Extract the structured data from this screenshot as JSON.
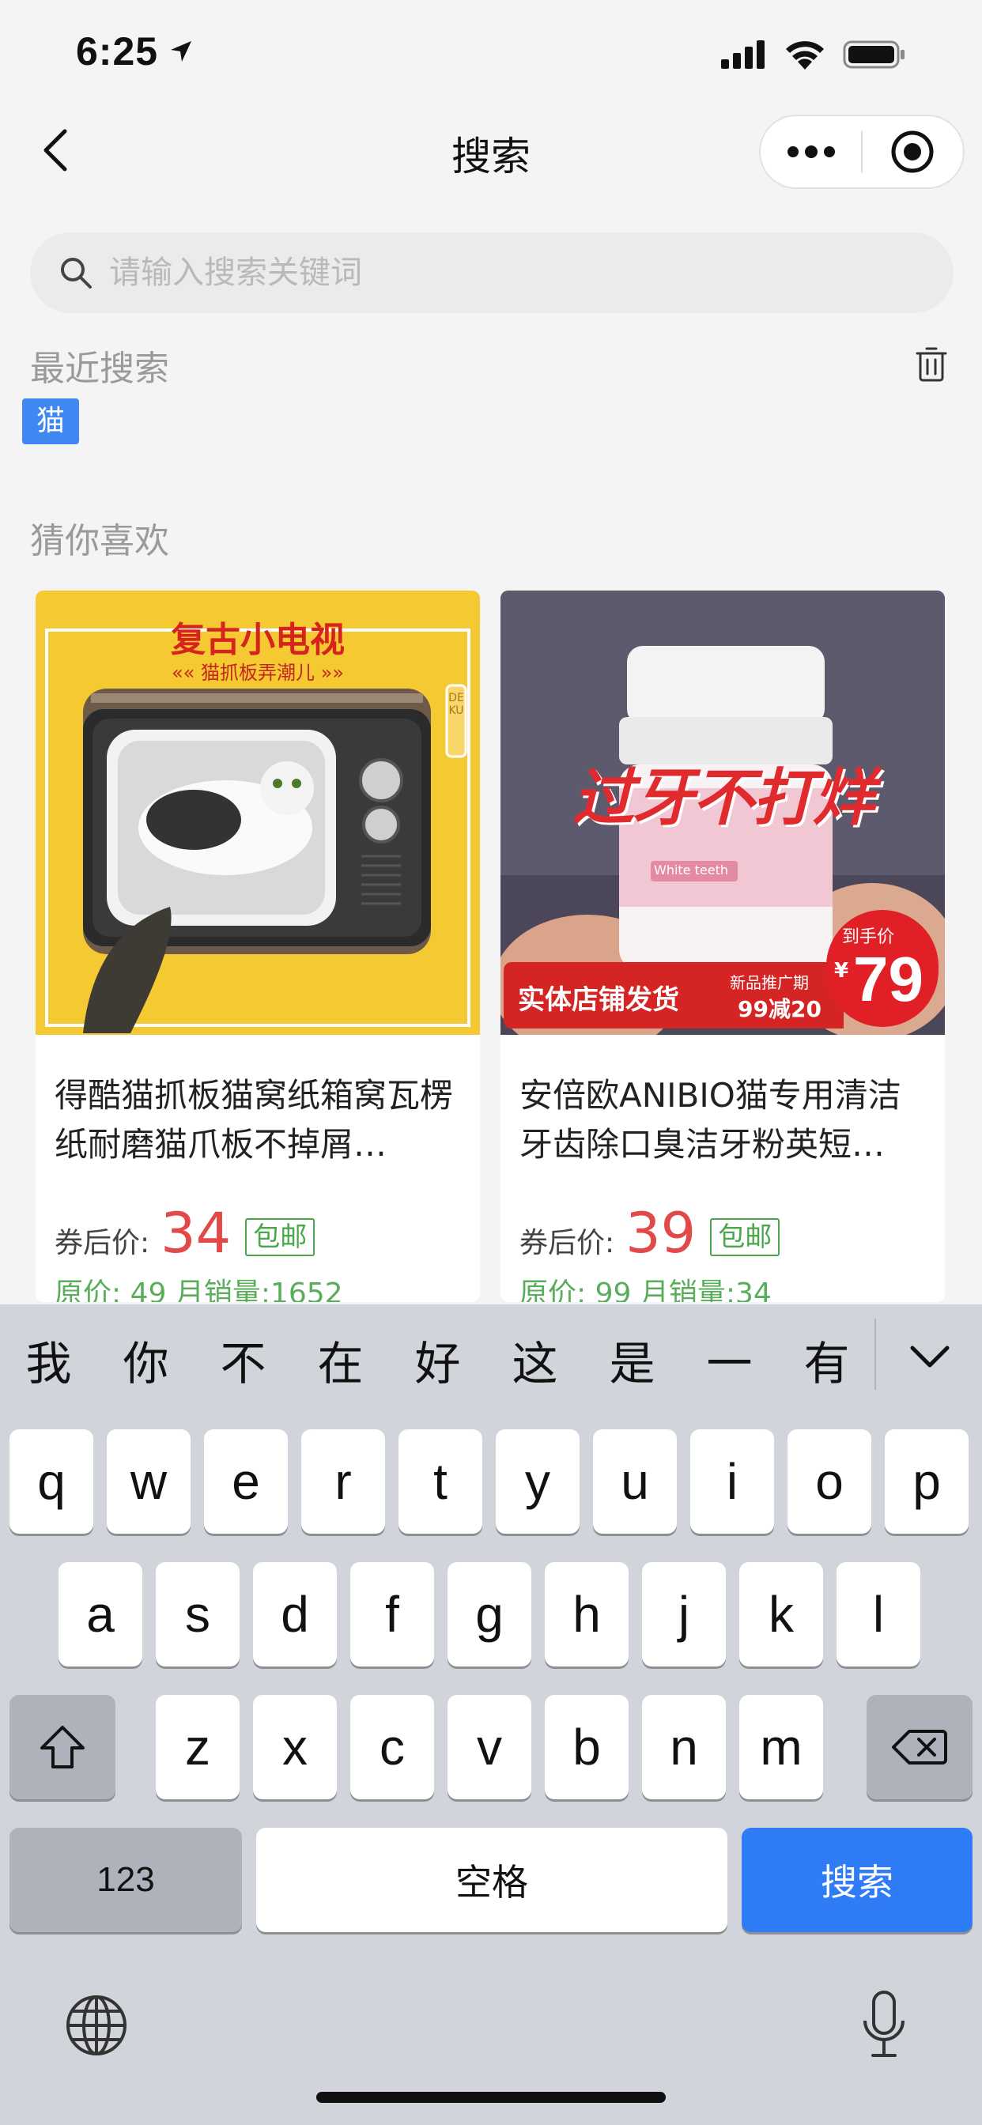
{
  "status_bar": {
    "time": "6:25"
  },
  "nav": {
    "title": "搜索"
  },
  "search": {
    "placeholder": "请输入搜索关键词"
  },
  "recent": {
    "title": "最近搜索",
    "tags": [
      "猫"
    ]
  },
  "recommend": {
    "title": "猜你喜欢",
    "products": [
      {
        "title": "得酷猫抓板猫窝纸箱窝瓦楞纸耐磨猫爪板不掉屑…",
        "price_label": "券后价:",
        "price": "34",
        "badge": "包邮",
        "meta": "原价: 49   月销量:1652",
        "image": {
          "banner": "复古小电视",
          "subtitle": "猫抓板弄潮儿",
          "brand": "DEKU"
        }
      },
      {
        "title": "安倍欧ANIBIO猫专用清洁牙齿除口臭洁牙粉英短…",
        "price_label": "券后价:",
        "price": "39",
        "badge": "包邮",
        "meta": "原价: 99   月销量:34",
        "image": {
          "headline": "过牙不打烊",
          "jar_label": "White teeth",
          "store": "实体店铺发货",
          "promo_top": "新品推广期",
          "promo_bottom": "99减20",
          "final_label": "到手价",
          "final_currency": "¥",
          "final_price": "79"
        }
      }
    ]
  },
  "keyboard": {
    "candidates": [
      "我",
      "你",
      "不",
      "在",
      "好",
      "这",
      "是",
      "一",
      "有"
    ],
    "row1": [
      "q",
      "w",
      "e",
      "r",
      "t",
      "y",
      "u",
      "i",
      "o",
      "p"
    ],
    "row2": [
      "a",
      "s",
      "d",
      "f",
      "g",
      "h",
      "j",
      "k",
      "l"
    ],
    "row3": [
      "z",
      "x",
      "c",
      "v",
      "b",
      "n",
      "m"
    ],
    "num_label": "123",
    "space_label": "空格",
    "action_label": "搜索"
  },
  "colors": {
    "accent_blue": "#2f7cf6",
    "tag_blue": "#3f88f2",
    "price_red": "#e24a4a",
    "badge_green": "#4aa64a"
  }
}
